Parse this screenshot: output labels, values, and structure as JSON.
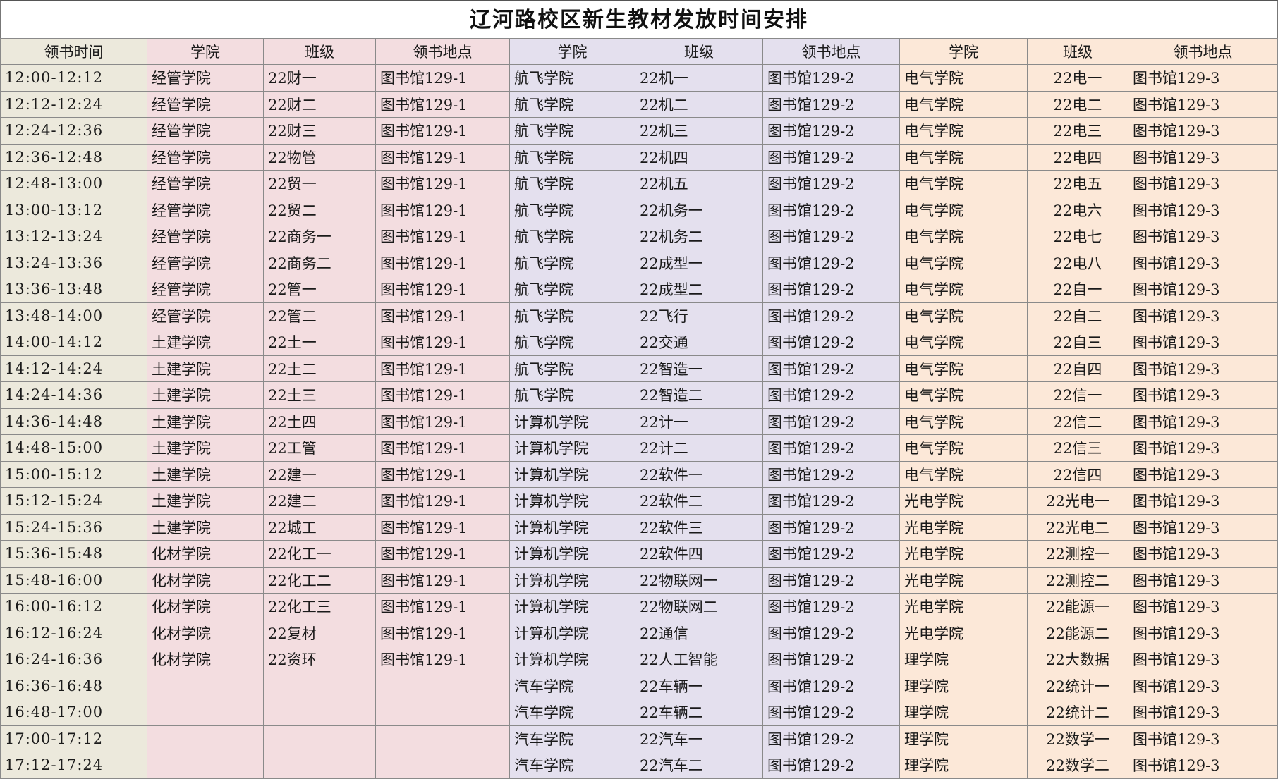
{
  "title": "辽河路校区新生教材发放时间安排",
  "colors": {
    "time_bg": "#ece9dc",
    "group1_bg": "#f3dde0",
    "group2_bg": "#e4e0ee",
    "group3_bg": "#fce8d8"
  },
  "headers": [
    "领书时间",
    "学院",
    "班级",
    "领书地点",
    "学院",
    "班级",
    "领书地点",
    "学院",
    "班级",
    "领书地点"
  ],
  "rows": [
    [
      "12:00-12:12",
      "经管学院",
      "22财一",
      "图书馆129-1",
      "航飞学院",
      "22机一",
      "图书馆129-2",
      "电气学院",
      "22电一",
      "图书馆129-3"
    ],
    [
      "12:12-12:24",
      "经管学院",
      "22财二",
      "图书馆129-1",
      "航飞学院",
      "22机二",
      "图书馆129-2",
      "电气学院",
      "22电二",
      "图书馆129-3"
    ],
    [
      "12:24-12:36",
      "经管学院",
      "22财三",
      "图书馆129-1",
      "航飞学院",
      "22机三",
      "图书馆129-2",
      "电气学院",
      "22电三",
      "图书馆129-3"
    ],
    [
      "12:36-12:48",
      "经管学院",
      "22物管",
      "图书馆129-1",
      "航飞学院",
      "22机四",
      "图书馆129-2",
      "电气学院",
      "22电四",
      "图书馆129-3"
    ],
    [
      "12:48-13:00",
      "经管学院",
      "22贸一",
      "图书馆129-1",
      "航飞学院",
      "22机五",
      "图书馆129-2",
      "电气学院",
      "22电五",
      "图书馆129-3"
    ],
    [
      "13:00-13:12",
      "经管学院",
      "22贸二",
      "图书馆129-1",
      "航飞学院",
      "22机务一",
      "图书馆129-2",
      "电气学院",
      "22电六",
      "图书馆129-3"
    ],
    [
      "13:12-13:24",
      "经管学院",
      "22商务一",
      "图书馆129-1",
      "航飞学院",
      "22机务二",
      "图书馆129-2",
      "电气学院",
      "22电七",
      "图书馆129-3"
    ],
    [
      "13:24-13:36",
      "经管学院",
      "22商务二",
      "图书馆129-1",
      "航飞学院",
      "22成型一",
      "图书馆129-2",
      "电气学院",
      "22电八",
      "图书馆129-3"
    ],
    [
      "13:36-13:48",
      "经管学院",
      "22管一",
      "图书馆129-1",
      "航飞学院",
      "22成型二",
      "图书馆129-2",
      "电气学院",
      "22自一",
      "图书馆129-3"
    ],
    [
      "13:48-14:00",
      "经管学院",
      "22管二",
      "图书馆129-1",
      "航飞学院",
      "22飞行",
      "图书馆129-2",
      "电气学院",
      "22自二",
      "图书馆129-3"
    ],
    [
      "14:00-14:12",
      "土建学院",
      "22土一",
      "图书馆129-1",
      "航飞学院",
      "22交通",
      "图书馆129-2",
      "电气学院",
      "22自三",
      "图书馆129-3"
    ],
    [
      "14:12-14:24",
      "土建学院",
      "22土二",
      "图书馆129-1",
      "航飞学院",
      "22智造一",
      "图书馆129-2",
      "电气学院",
      "22自四",
      "图书馆129-3"
    ],
    [
      "14:24-14:36",
      "土建学院",
      "22土三",
      "图书馆129-1",
      "航飞学院",
      "22智造二",
      "图书馆129-2",
      "电气学院",
      "22信一",
      "图书馆129-3"
    ],
    [
      "14:36-14:48",
      "土建学院",
      "22土四",
      "图书馆129-1",
      "计算机学院",
      "22计一",
      "图书馆129-2",
      "电气学院",
      "22信二",
      "图书馆129-3"
    ],
    [
      "14:48-15:00",
      "土建学院",
      "22工管",
      "图书馆129-1",
      "计算机学院",
      "22计二",
      "图书馆129-2",
      "电气学院",
      "22信三",
      "图书馆129-3"
    ],
    [
      "15:00-15:12",
      "土建学院",
      "22建一",
      "图书馆129-1",
      "计算机学院",
      "22软件一",
      "图书馆129-2",
      "电气学院",
      "22信四",
      "图书馆129-3"
    ],
    [
      "15:12-15:24",
      "土建学院",
      "22建二",
      "图书馆129-1",
      "计算机学院",
      "22软件二",
      "图书馆129-2",
      "光电学院",
      "22光电一",
      "图书馆129-3"
    ],
    [
      "15:24-15:36",
      "土建学院",
      "22城工",
      "图书馆129-1",
      "计算机学院",
      "22软件三",
      "图书馆129-2",
      "光电学院",
      "22光电二",
      "图书馆129-3"
    ],
    [
      "15:36-15:48",
      "化材学院",
      "22化工一",
      "图书馆129-1",
      "计算机学院",
      "22软件四",
      "图书馆129-2",
      "光电学院",
      "22测控一",
      "图书馆129-3"
    ],
    [
      "15:48-16:00",
      "化材学院",
      "22化工二",
      "图书馆129-1",
      "计算机学院",
      "22物联网一",
      "图书馆129-2",
      "光电学院",
      "22测控二",
      "图书馆129-3"
    ],
    [
      "16:00-16:12",
      "化材学院",
      "22化工三",
      "图书馆129-1",
      "计算机学院",
      "22物联网二",
      "图书馆129-2",
      "光电学院",
      "22能源一",
      "图书馆129-3"
    ],
    [
      "16:12-16:24",
      "化材学院",
      "22复材",
      "图书馆129-1",
      "计算机学院",
      "22通信",
      "图书馆129-2",
      "光电学院",
      "22能源二",
      "图书馆129-3"
    ],
    [
      "16:24-16:36",
      "化材学院",
      "22资环",
      "图书馆129-1",
      "计算机学院",
      "22人工智能",
      "图书馆129-2",
      "理学院",
      "22大数据",
      "图书馆129-3"
    ],
    [
      "16:36-16:48",
      "",
      "",
      "",
      "汽车学院",
      "22车辆一",
      "图书馆129-2",
      "理学院",
      "22统计一",
      "图书馆129-3"
    ],
    [
      "16:48-17:00",
      "",
      "",
      "",
      "汽车学院",
      "22车辆二",
      "图书馆129-2",
      "理学院",
      "22统计二",
      "图书馆129-3"
    ],
    [
      "17:00-17:12",
      "",
      "",
      "",
      "汽车学院",
      "22汽车一",
      "图书馆129-2",
      "理学院",
      "22数学一",
      "图书馆129-3"
    ],
    [
      "17:12-17:24",
      "",
      "",
      "",
      "汽车学院",
      "22汽车二",
      "图书馆129-2",
      "理学院",
      "22数学二",
      "图书馆129-3"
    ]
  ]
}
